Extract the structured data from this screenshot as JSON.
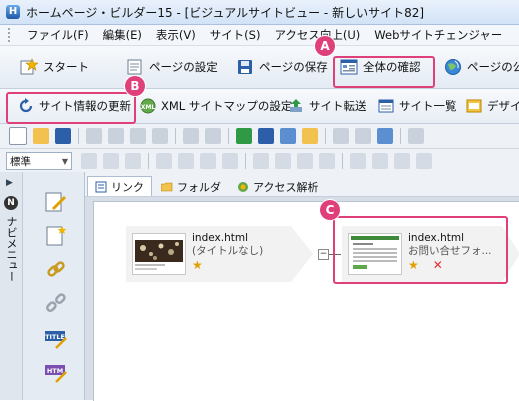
{
  "window": {
    "title": "ホームページ・ビルダー15 - [ビジュアルサイトビュー - 新しいサイト82]"
  },
  "menu": [
    "ファイル(F)",
    "編集(E)",
    "表示(V)",
    "サイト(S)",
    "アクセス向上(U)",
    "Webサイトチェンジャー"
  ],
  "main_toolbar": {
    "start": "スタート",
    "page_settings": "ページの設定",
    "save_page": "ページの保存",
    "check_all": "全体の確認",
    "publish": "ページの公"
  },
  "sub_toolbar": {
    "update_site_info": "サイト情報の更新",
    "xml_sitemap": "XML サイトマップの設定",
    "site_transfer": "サイト転送",
    "site_list": "サイト一覧",
    "design": "デザイ"
  },
  "format": {
    "style_value": "標準"
  },
  "left_nav": {
    "label": "ナビメニュー",
    "badge": "N"
  },
  "tabs": [
    "リンク",
    "フォルダ",
    "アクセス解析"
  ],
  "nodes": [
    {
      "file": "index.html",
      "title": "(タイトルなし)"
    },
    {
      "file": "index.html",
      "title": "お問い合せフォ..."
    }
  ],
  "markers": {
    "a": "A",
    "b": "B",
    "c": "C"
  },
  "colors": {
    "highlight": "#e0407a",
    "accent": "#1e5aa8"
  }
}
